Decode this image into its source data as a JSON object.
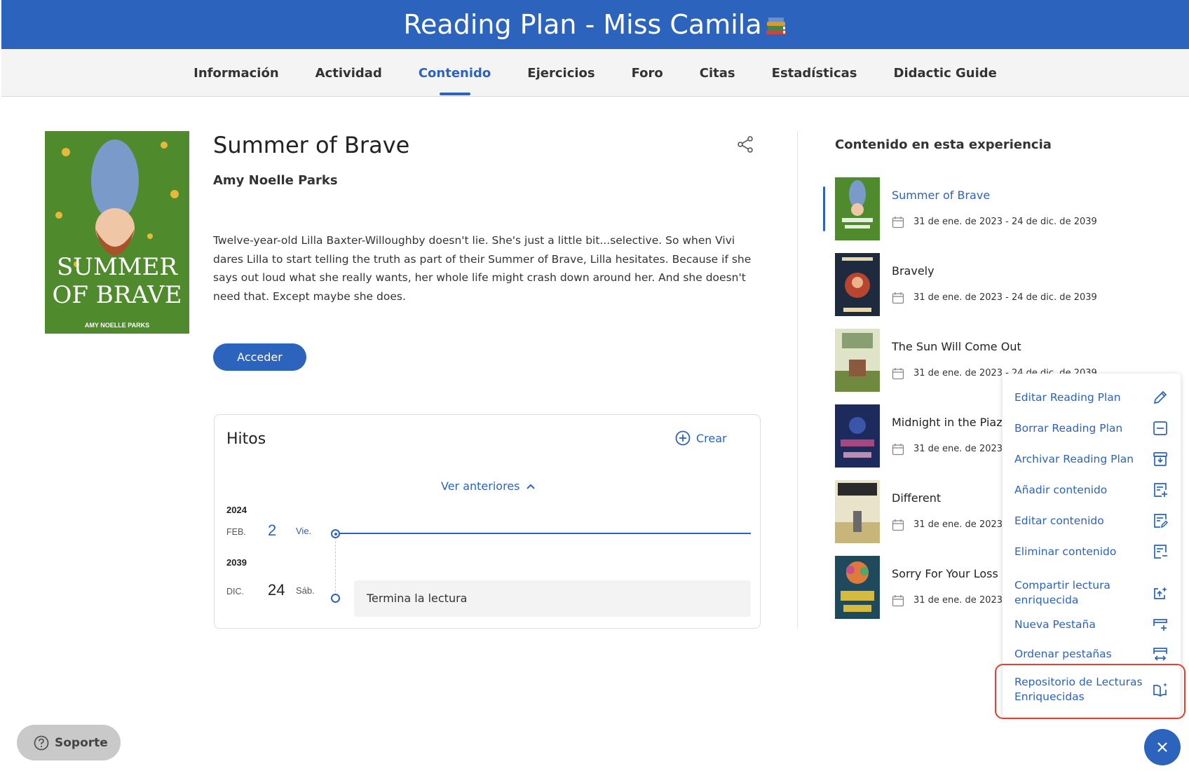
{
  "header": {
    "title": "Reading Plan - Miss Camila",
    "icon": "books-icon"
  },
  "tabs": [
    {
      "label": "Información",
      "active": false
    },
    {
      "label": "Actividad",
      "active": false
    },
    {
      "label": "Contenido",
      "active": true
    },
    {
      "label": "Ejercicios",
      "active": false
    },
    {
      "label": "Foro",
      "active": false
    },
    {
      "label": "Citas",
      "active": false
    },
    {
      "label": "Estadísticas",
      "active": false
    },
    {
      "label": "Didactic Guide",
      "active": false
    }
  ],
  "book": {
    "title": "Summer of Brave",
    "author": "Amy Noelle Parks",
    "cover_title_line1": "SUMMER",
    "cover_title_line2": "OF BRAVE",
    "cover_author": "AMY NOELLE PARKS",
    "description": "Twelve-year-old Lilla Baxter-Willoughby doesn't lie. She's just a little bit...selective. So when Vivi dares Lilla to start telling the truth as part of their Summer of Brave, Lilla hesitates. Because if she says out loud what she really wants, her whole life might crash down around her. And she doesn't need that. Except maybe she does.",
    "access_button": "Acceder"
  },
  "hitos": {
    "title": "Hitos",
    "create_label": "Crear",
    "see_previous": "Ver anteriores",
    "entries": [
      {
        "year": "2024",
        "month": "FEB.",
        "day": "2",
        "weekday": "Vie.",
        "event": ""
      },
      {
        "year": "2039",
        "month": "DIC.",
        "day": "24",
        "weekday": "Sáb.",
        "event": "Termina la lectura"
      }
    ]
  },
  "content_panel": {
    "title": "Contenido en esta experiencia",
    "items": [
      {
        "title": "Summer of Brave",
        "date": "31 de ene. de 2023 - 24 de dic. de 2039",
        "selected": true
      },
      {
        "title": "Bravely",
        "date": "31 de ene. de 2023 - 24 de dic. de 2039",
        "selected": false
      },
      {
        "title": "The Sun Will Come Out",
        "date": "31 de ene. de 2023 - 24 de dic. de 2039",
        "selected": false
      },
      {
        "title": "Midnight in the Piazza",
        "date": "31 de ene. de 2023 - 24 de dic. de 2039",
        "selected": false
      },
      {
        "title": "Different",
        "date": "31 de ene. de 2023 - 24 de dic. de 2039",
        "selected": false
      },
      {
        "title": "Sorry For Your Loss",
        "date": "31 de ene. de 2023 - 24 de dic. de 2039",
        "selected": false
      }
    ]
  },
  "menu": {
    "items": [
      {
        "label": "Editar Reading Plan",
        "icon": "pencil-icon"
      },
      {
        "label": "Borrar Reading Plan",
        "icon": "minus-box-icon"
      },
      {
        "label": "Archivar Reading Plan",
        "icon": "archive-icon"
      },
      {
        "label": "Añadir contenido",
        "icon": "add-content-icon"
      },
      {
        "label": "Editar contenido",
        "icon": "edit-content-icon"
      },
      {
        "label": "Eliminar contenido",
        "icon": "delete-content-icon"
      },
      {
        "label": "Compartir lectura enriquecida",
        "icon": "share-enriched-icon"
      },
      {
        "label": "Nueva Pestaña",
        "icon": "new-tab-icon"
      },
      {
        "label": "Ordenar pestañas",
        "icon": "sort-tabs-icon"
      },
      {
        "label": "Repositorio de Lecturas Enriquecidas",
        "icon": "book-sparkle-icon",
        "highlighted": true
      }
    ]
  },
  "support_label": "Soporte",
  "colors": {
    "primary": "#2b63bd",
    "highlight": "#e0402d",
    "support_bg": "#c9c9c9"
  }
}
